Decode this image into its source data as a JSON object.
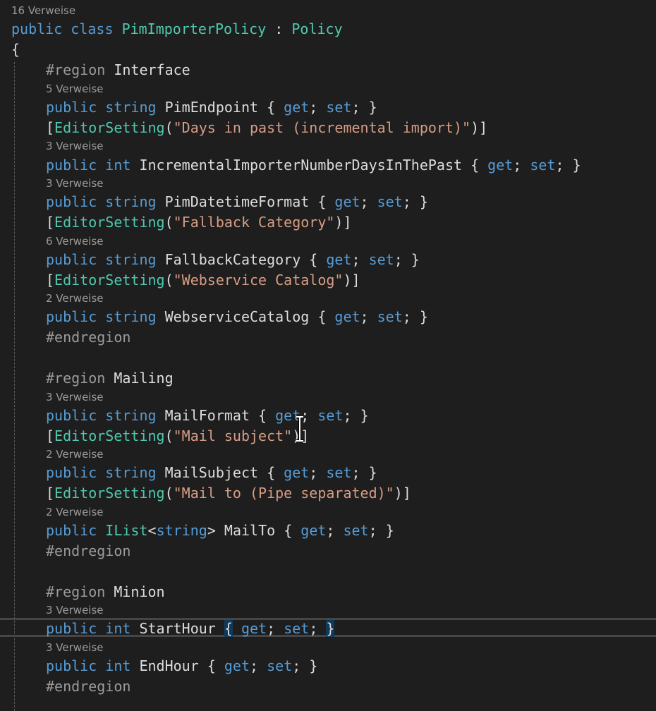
{
  "references": {
    "class": "16 Verweise",
    "pim_endpoint": "5 Verweise",
    "incremental_days": "3 Verweise",
    "pim_datetime_format": "3 Verweise",
    "fallback_category": "6 Verweise",
    "webservice_catalog": "2 Verweise",
    "mail_format": "3 Verweise",
    "mail_subject": "2 Verweise",
    "mail_to": "2 Verweise",
    "start_hour": "3 Verweise",
    "end_hour": "3 Verweise"
  },
  "code": {
    "class_public": "public",
    "class_kw": "class",
    "class_name": "PimImporterPolicy",
    "class_sep": " : ",
    "base_class": "Policy",
    "open_brace": "{",
    "region_kw": "#region",
    "endregion": "#endregion",
    "region_interface": "Interface",
    "region_mailing": "Mailing",
    "region_minion": "Minion",
    "kw_public": "public",
    "kw_string": "string",
    "kw_int": "int",
    "kw_get": "get",
    "kw_set": "set",
    "attr_name": "EditorSetting",
    "prop_pim_endpoint": "PimEndpoint",
    "str_days_in_past": "\"Days in past (incremental import)\"",
    "prop_incremental_days": "IncrementalImporterNumberDaysInThePast",
    "prop_pim_datetime_format": "PimDatetimeFormat",
    "str_fallback_category": "\"Fallback Category\"",
    "prop_fallback_category": "FallbackCategory",
    "str_webservice_catalog": "\"Webservice Catalog\"",
    "prop_webservice_catalog": "WebserviceCatalog",
    "prop_mail_format": "MailFormat",
    "str_mail_subject": "\"Mail subject\"",
    "prop_mail_subject": "MailSubject",
    "str_mail_to": "\"Mail to (Pipe separated)\"",
    "type_ilist": "IList",
    "prop_mail_to": "MailTo",
    "prop_start_hour": "StartHour",
    "prop_end_hour": "EndHour"
  },
  "colors": {
    "background": "#1e1e1e",
    "keyword": "#569cd6",
    "type": "#4ec9b0",
    "string": "#d69d85",
    "identifier": "#dcdcdc",
    "preprocessor": "#9b9b9b",
    "codelens": "#9a9a9a"
  },
  "cursor": {
    "icon": "ibeam-cursor-icon"
  }
}
